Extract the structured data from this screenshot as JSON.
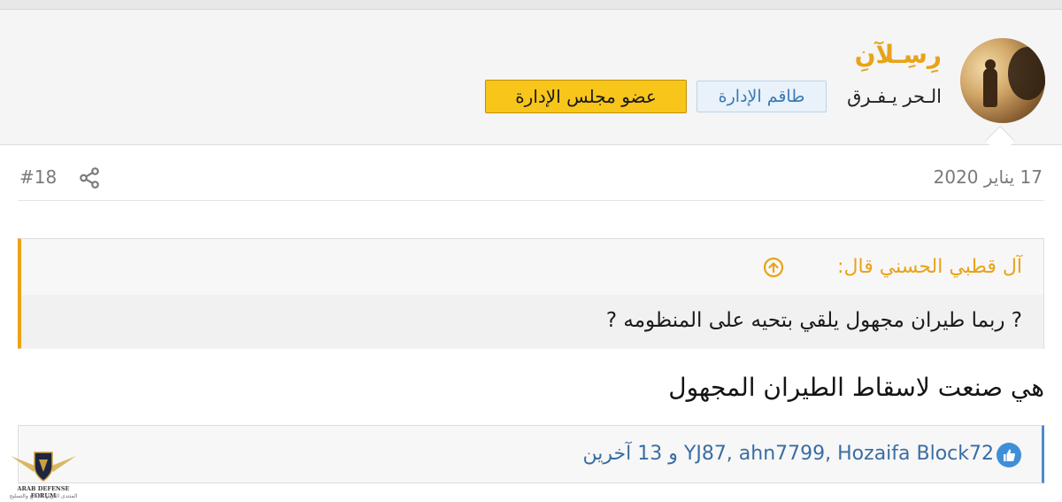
{
  "user": {
    "username": "رِسِـلآنِ",
    "user_title": "الـحر يـفـرق",
    "badge_staff": "طاقم الإدارة",
    "badge_board": "عضو مجلس الإدارة"
  },
  "post": {
    "date": "17 يناير 2020",
    "number": "#18",
    "quote_author": "آل قطبي الحسني قال:",
    "quote_text": "? ربما طيران مجهول يلقي بتحيه على المنظومه ?",
    "message": "هي صنعت لاسقاط الطيران المجهول",
    "likes_text": "YJ87, ahn7799, Hozaifa Block72 و 13 آخرين"
  },
  "watermark": {
    "line1": "ARAB DEFENSE FORUM",
    "line2": "المنتدى العربي للدفاع والتسليح"
  },
  "colors": {
    "accent": "#e8a317",
    "link": "#3a6da3",
    "badge_staff_bg": "#e9f2fa",
    "badge_board_bg": "#f8c51a"
  },
  "icons": [
    "share-icon",
    "quote-arrow-icon",
    "like-icon"
  ]
}
